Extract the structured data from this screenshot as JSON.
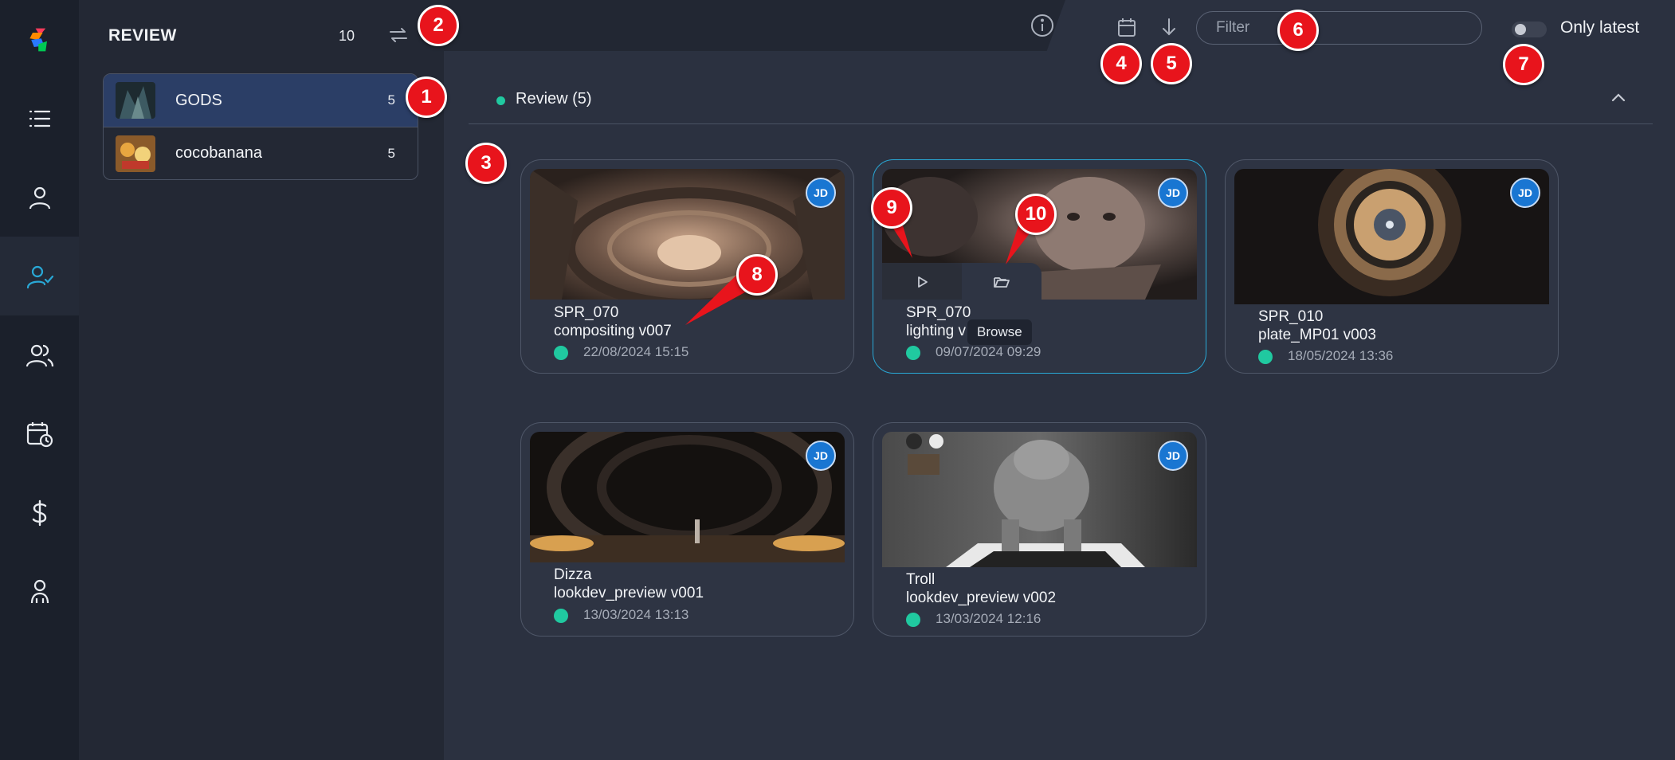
{
  "rail": {
    "items": [
      {
        "name": "app-logo",
        "icon": "logo-icon"
      },
      {
        "name": "list",
        "icon": "list-icon"
      },
      {
        "name": "user",
        "icon": "user-icon"
      },
      {
        "name": "review",
        "icon": "user-check-icon",
        "active": true
      },
      {
        "name": "team",
        "icon": "users-icon"
      },
      {
        "name": "schedule",
        "icon": "calendar-clock-icon"
      },
      {
        "name": "budget",
        "icon": "dollar-icon"
      },
      {
        "name": "people",
        "icon": "people-icon"
      }
    ]
  },
  "panel": {
    "title": "REVIEW",
    "count": "10",
    "projects": [
      {
        "name": "GODS",
        "count": "5",
        "active": true
      },
      {
        "name": "cocobanana",
        "count": "5",
        "active": false
      }
    ]
  },
  "topbar": {
    "filter_placeholder": "Filter",
    "toggle_label": "Only latest",
    "toggle_on": false
  },
  "section": {
    "title": "Review (5)",
    "status_color": "#20c9a0"
  },
  "cards": [
    {
      "line1": "SPR_070",
      "line2": "compositing v007",
      "date": "22/08/2024 15:15",
      "avatar": "JD"
    },
    {
      "line1": "SPR_070",
      "line2": "lighting v",
      "date": "09/07/2024 09:29",
      "avatar": "JD",
      "tooltip": "Browse"
    },
    {
      "line1": "SPR_010",
      "line2": "plate_MP01 v003",
      "date": "18/05/2024 13:36",
      "avatar": "JD"
    },
    {
      "line1": "Dizza",
      "line2": "lookdev_preview v001",
      "date": "13/03/2024 13:13",
      "avatar": "JD"
    },
    {
      "line1": "Troll",
      "line2": "lookdev_preview v002",
      "date": "13/03/2024 12:16",
      "avatar": "JD"
    }
  ],
  "callouts": [
    "1",
    "2",
    "3",
    "4",
    "5",
    "6",
    "7",
    "8",
    "9",
    "10"
  ],
  "colors": {
    "accent": "#20c9a0",
    "selection": "#29a8d6",
    "avatar": "#1976d2",
    "callout": "#e8141c"
  }
}
